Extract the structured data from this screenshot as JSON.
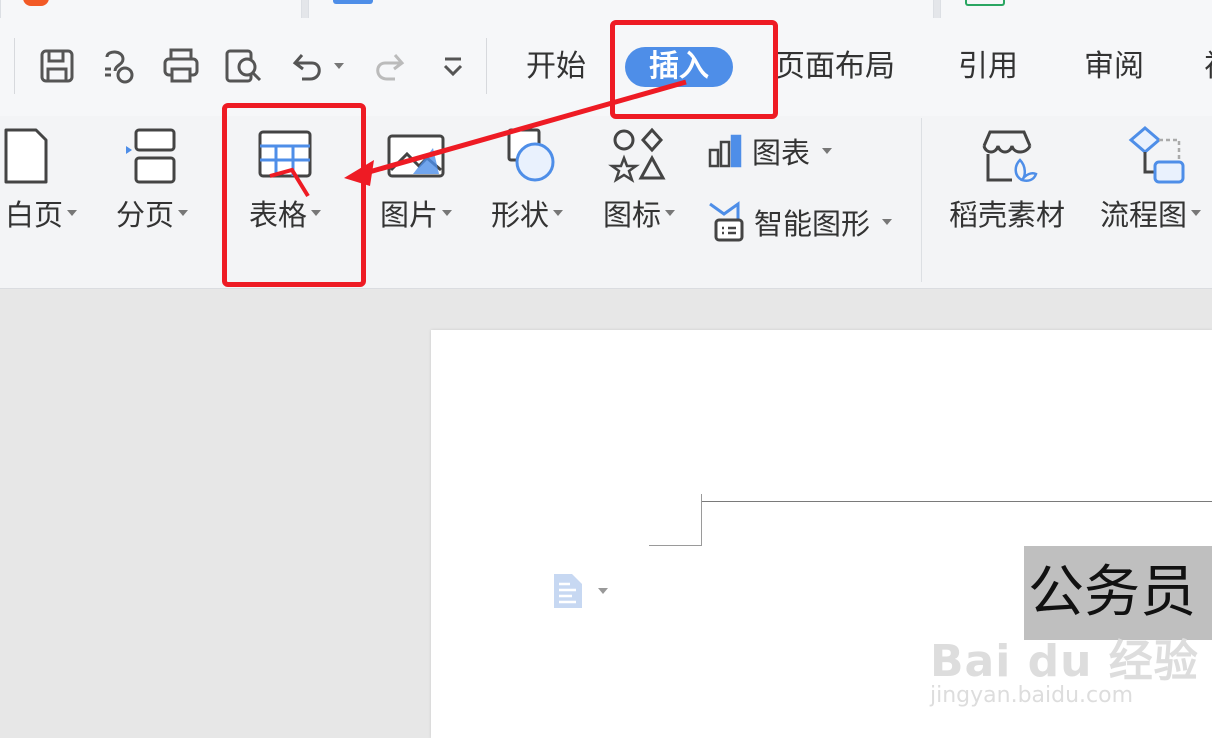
{
  "menu": {
    "tabs": [
      {
        "label": "开始"
      },
      {
        "label": "插入"
      },
      {
        "label": "页面布局"
      },
      {
        "label": "引用"
      },
      {
        "label": "审阅"
      },
      {
        "label": "视"
      }
    ]
  },
  "ribbon": {
    "blank_page": "白页",
    "page_break": "分页",
    "table": "表格",
    "picture": "图片",
    "shape": "形状",
    "icon": "图标",
    "chart": "图表",
    "smart_art": "智能图形",
    "docer_material": "稻壳素材",
    "flowchart": "流程图"
  },
  "document": {
    "heading_text": "公务员"
  },
  "watermark": {
    "brand": "Bai du 经验",
    "url": "jingyan.baidu.com"
  },
  "colors": {
    "accent": "#4e8ee8",
    "highlight": "#ee1b24"
  }
}
